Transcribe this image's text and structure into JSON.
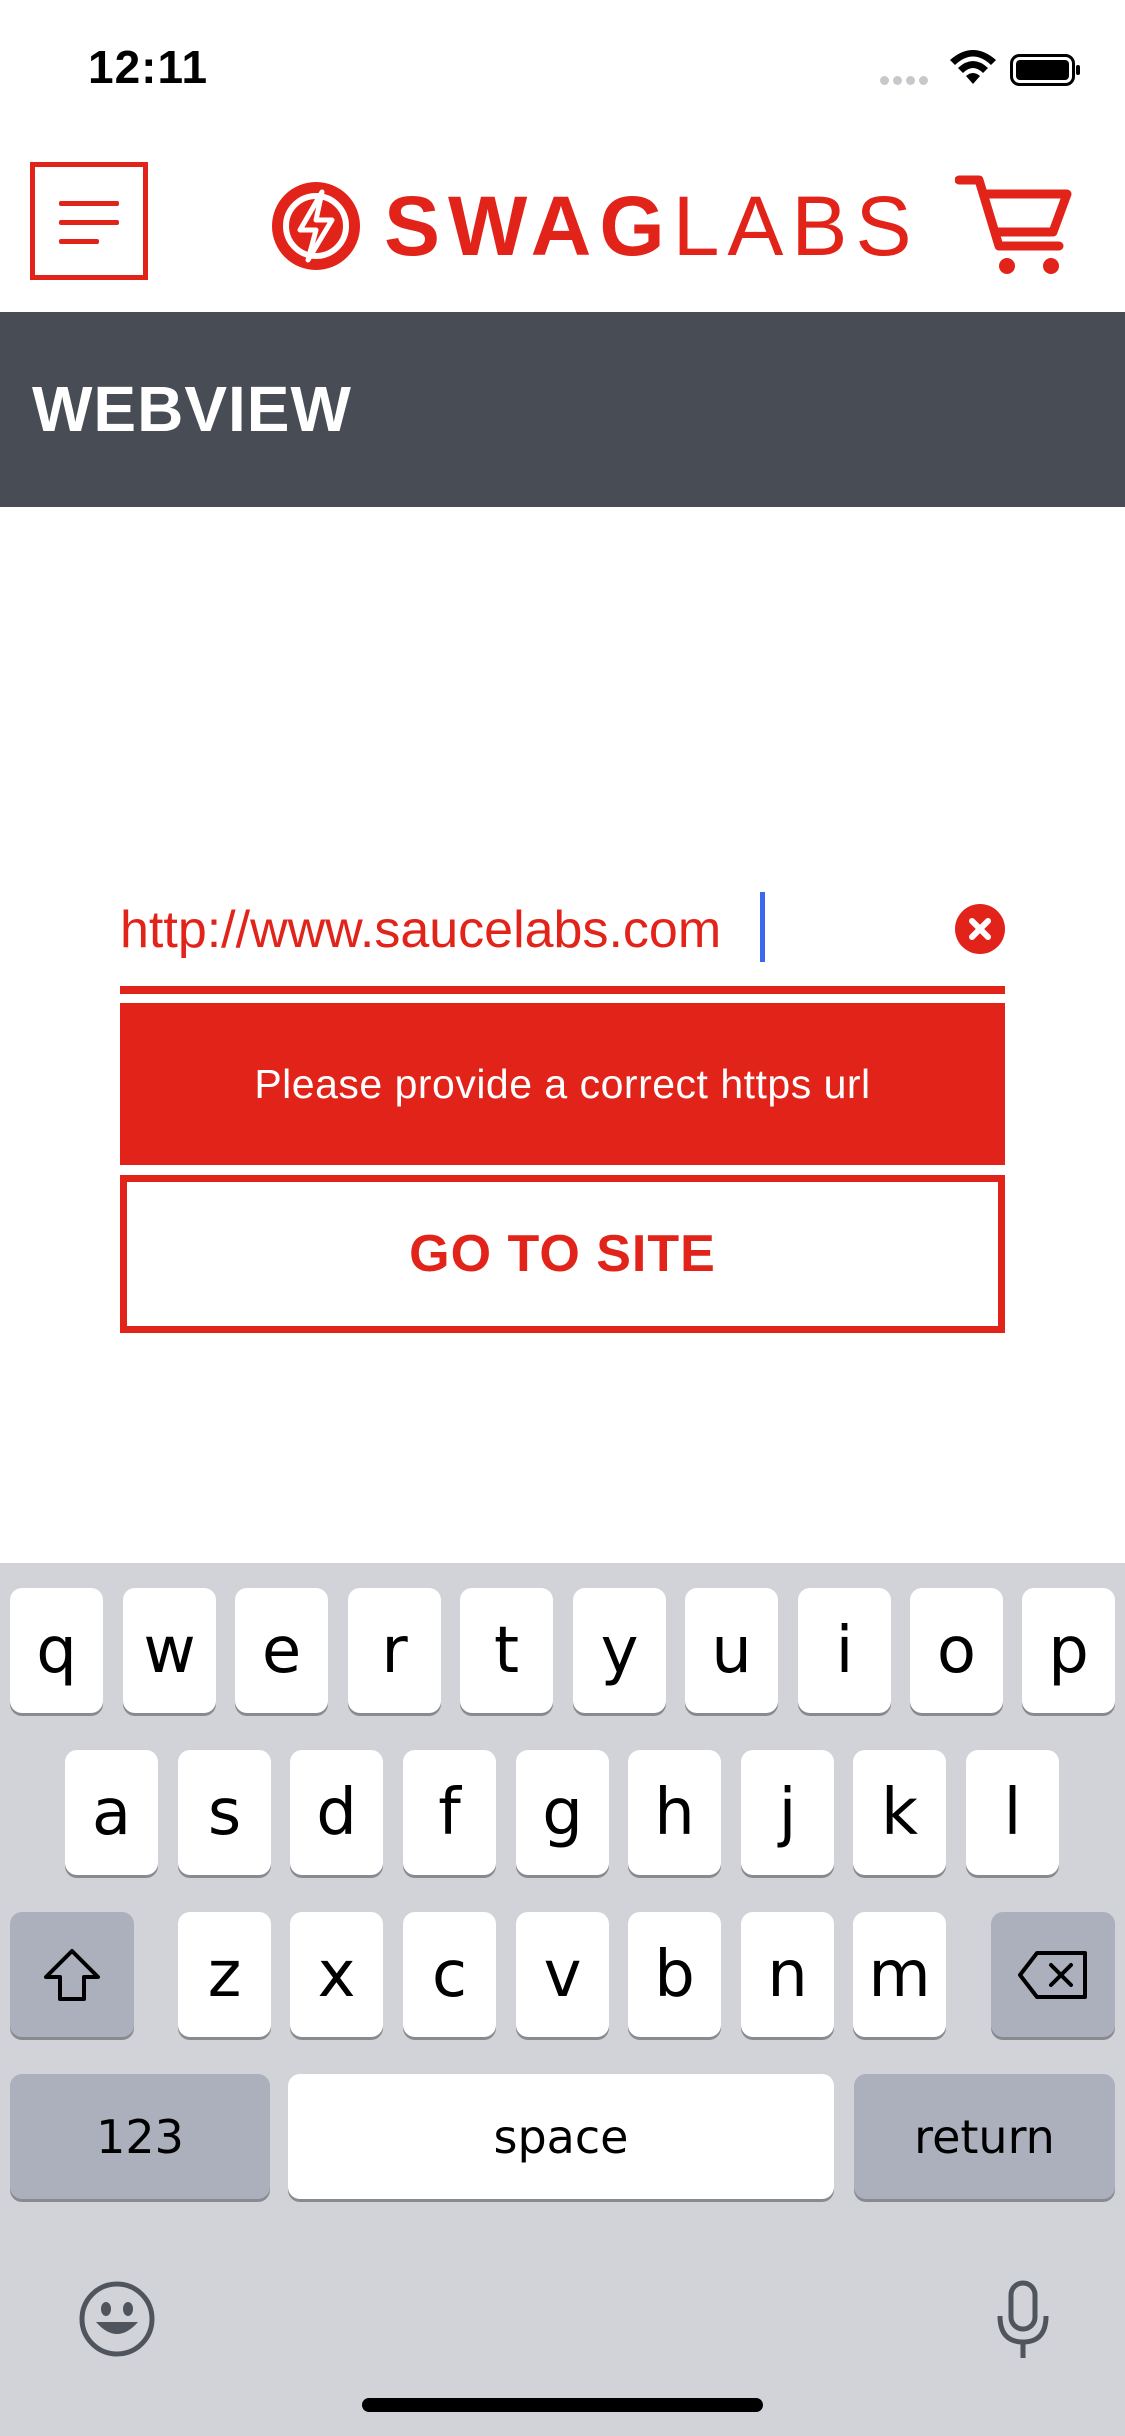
{
  "status_bar": {
    "time": "12:11"
  },
  "header": {
    "logo_bold": "SWAG",
    "logo_light": "LABS",
    "accent_color": "#e2231a",
    "menu_icon": "hamburger-menu-icon",
    "cart_icon": "shopping-cart-icon"
  },
  "title_bar": {
    "title": "WEBVIEW",
    "background": "#484c55"
  },
  "form": {
    "url_value": "http://www.saucelabs.com",
    "error_message": "Please provide a correct https url",
    "submit_label": "GO TO SITE"
  },
  "keyboard": {
    "row1": [
      "q",
      "w",
      "e",
      "r",
      "t",
      "y",
      "u",
      "i",
      "o",
      "p"
    ],
    "row2": [
      "a",
      "s",
      "d",
      "f",
      "g",
      "h",
      "j",
      "k",
      "l"
    ],
    "row3": [
      "z",
      "x",
      "c",
      "v",
      "b",
      "n",
      "m"
    ],
    "numbers_label": "123",
    "space_label": "space",
    "return_label": "return"
  }
}
